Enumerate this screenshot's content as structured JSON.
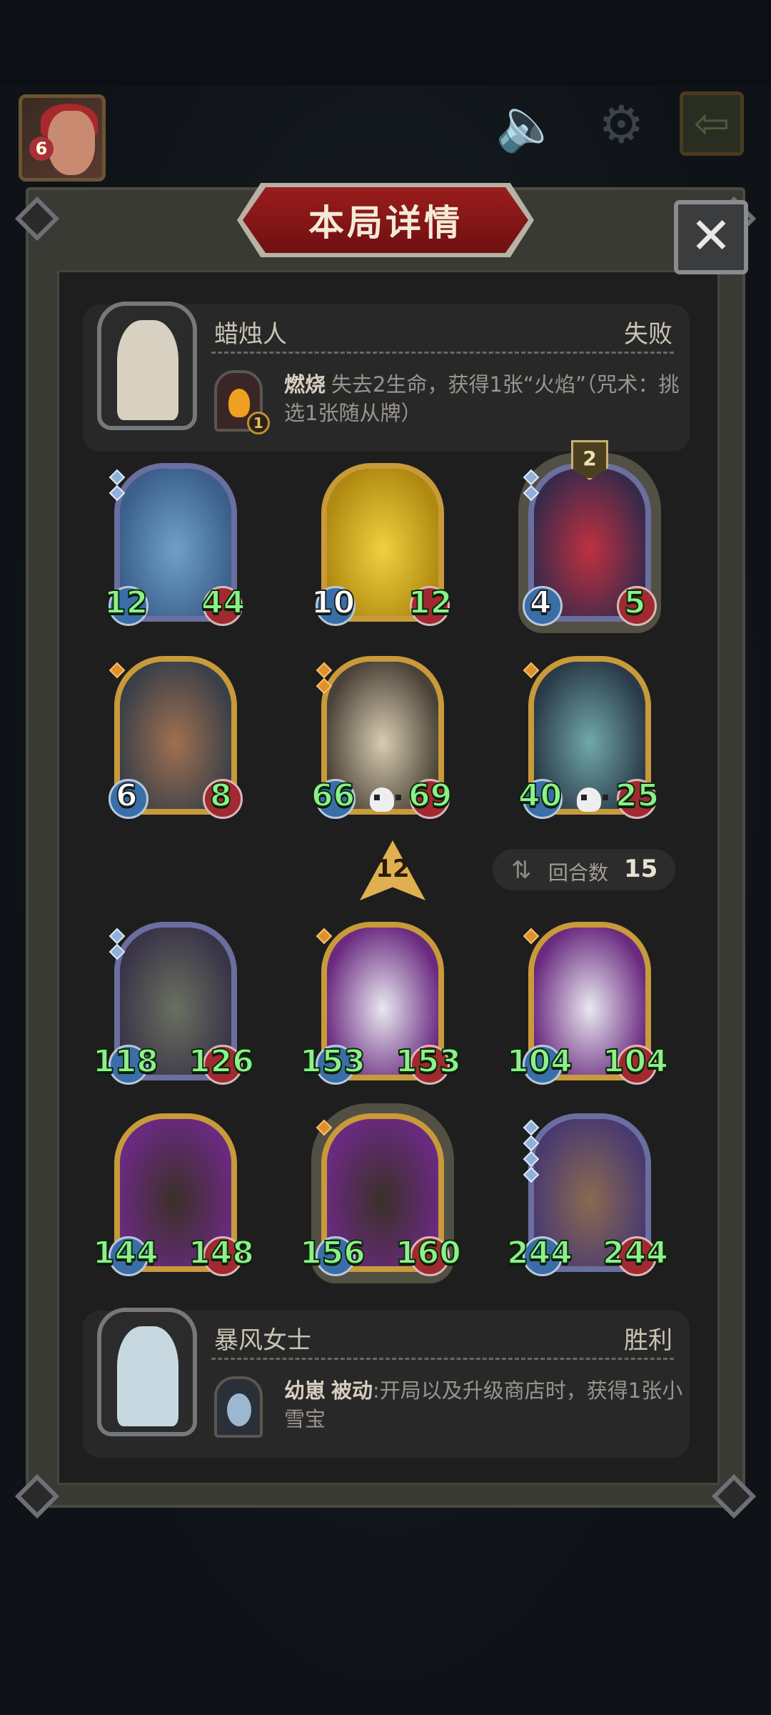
{
  "header": {
    "level": "6",
    "mute_icon": "speaker-mute-icon",
    "settings_icon": "gear-icon",
    "exit_icon": "exit-arrow-icon"
  },
  "panel": {
    "title": "本局详情",
    "close_icon": "close-icon"
  },
  "opponent": {
    "name": "蜡烛人",
    "result": "失败",
    "ability_name": "燃烧",
    "ability_level": "1",
    "ability_desc": "失去2生命，获得1张“火焰”（咒术：挑选1张随从牌）"
  },
  "opponent_board": [
    {
      "attack": "12",
      "health": "44",
      "tier_gems": 2,
      "gem_color": "blue",
      "frame": "silver",
      "art": "blue-dragon"
    },
    {
      "attack": "10",
      "health": "12",
      "tier_gems": 0,
      "gem_color": "",
      "frame": "gold",
      "art": "golden-dragon"
    },
    {
      "attack": "4",
      "health": "5",
      "tier_gems": 2,
      "gem_color": "blue",
      "frame": "silver",
      "art": "clown",
      "badge": "2",
      "attack_white": true
    },
    {
      "attack": "6",
      "health": "8",
      "tier_gems": 1,
      "gem_color": "orange",
      "frame": "gold",
      "art": "zeppelin"
    },
    {
      "attack": "66",
      "health": "69",
      "tier_gems": 2,
      "gem_color": "orange",
      "frame": "gold",
      "art": "bone-dragon",
      "skull": true
    },
    {
      "attack": "40",
      "health": "25",
      "tier_gems": 1,
      "gem_color": "orange",
      "frame": "gold",
      "art": "rabbit-robot",
      "skull": true
    }
  ],
  "middle": {
    "rank": "12",
    "turn_label": "回合数",
    "turn_value": "15"
  },
  "player_board": [
    {
      "attack": "118",
      "health": "126",
      "tier_gems": 2,
      "gem_color": "blue",
      "frame": "silver",
      "art": "stone-golem"
    },
    {
      "attack": "153",
      "health": "153",
      "tier_gems": 1,
      "gem_color": "orange",
      "frame": "gold",
      "art": "husky"
    },
    {
      "attack": "104",
      "health": "104",
      "tier_gems": 1,
      "gem_color": "orange",
      "frame": "gold",
      "art": "husky"
    },
    {
      "attack": "144",
      "health": "148",
      "tier_gems": 0,
      "gem_color": "",
      "frame": "gold",
      "art": "scarecrow"
    },
    {
      "attack": "156",
      "health": "160",
      "tier_gems": 1,
      "gem_color": "orange",
      "frame": "gold",
      "art": "scarecrow"
    },
    {
      "attack": "244",
      "health": "244",
      "tier_gems": 4,
      "gem_color": "blue",
      "frame": "silver",
      "art": "bulldog"
    }
  ],
  "player": {
    "name": "暴风女士",
    "result": "胜利",
    "ability_name": "幼崽",
    "ability_type": "被动",
    "ability_desc": ":开局以及升级商店时，获得1张小雪宝"
  }
}
